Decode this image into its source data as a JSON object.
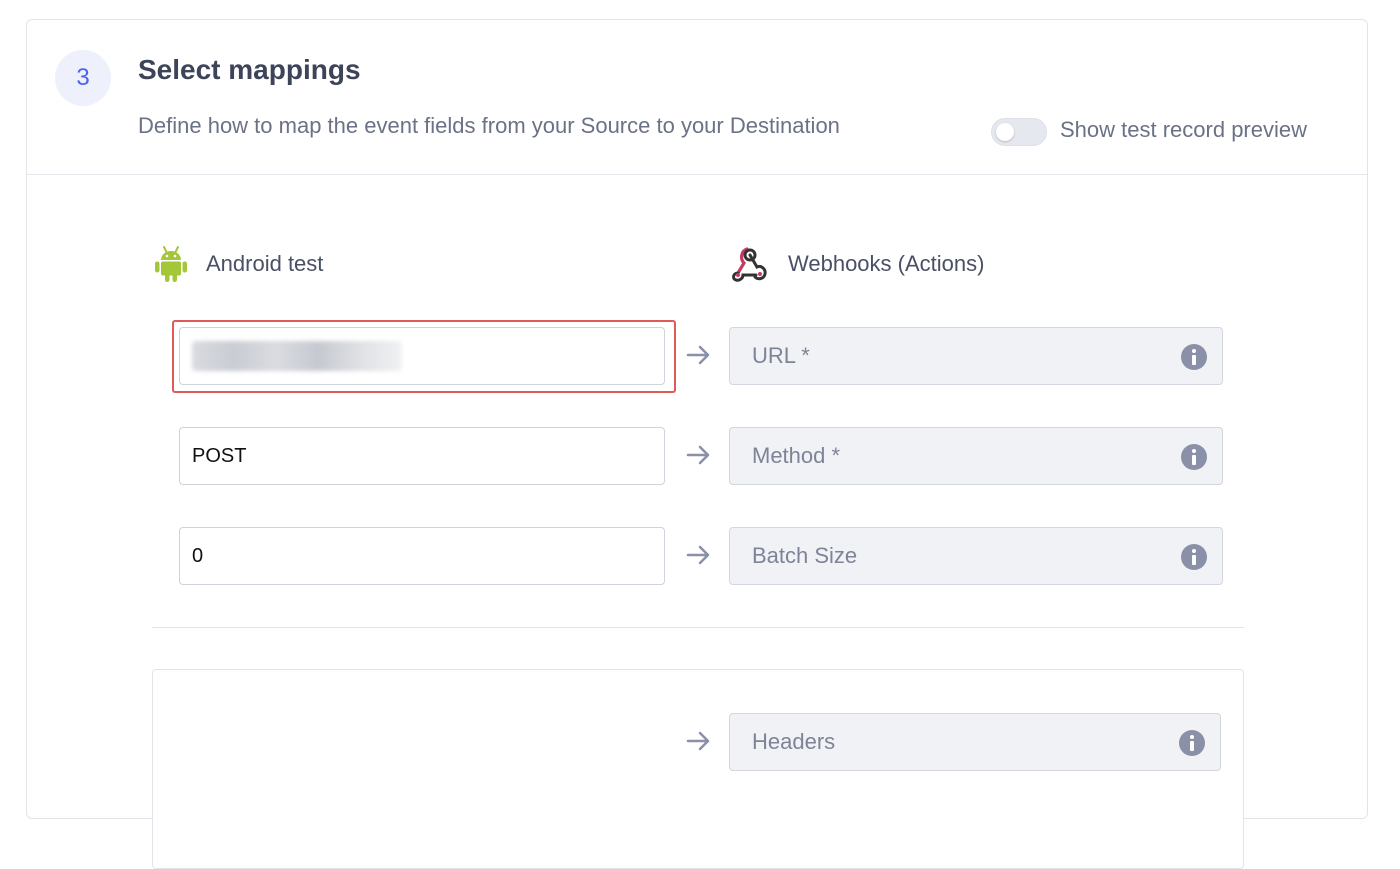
{
  "step": {
    "number": "3",
    "title": "Select mappings",
    "subtitle": "Define how to map the event fields from your Source to your Destination"
  },
  "preview_toggle": {
    "label": "Show test record preview",
    "enabled": false
  },
  "source": {
    "name": "Android test",
    "icon": "android-icon",
    "icon_color": "#a4c639"
  },
  "destination": {
    "name": "Webhooks (Actions)",
    "icon": "webhooks-icon",
    "icon_color": "#c73a63"
  },
  "mappings": [
    {
      "source_value": "",
      "source_blurred": true,
      "target": "URL *"
    },
    {
      "source_value": "POST",
      "source_blurred": false,
      "target": "Method *"
    },
    {
      "source_value": "0",
      "source_blurred": false,
      "target": "Batch Size"
    }
  ],
  "headers_mapping": {
    "target": "Headers"
  },
  "colors": {
    "accent": "#4a63f0",
    "highlight_border": "#e05a5a",
    "arrow": "#8a90a8",
    "info_icon": "#8a90a8"
  }
}
